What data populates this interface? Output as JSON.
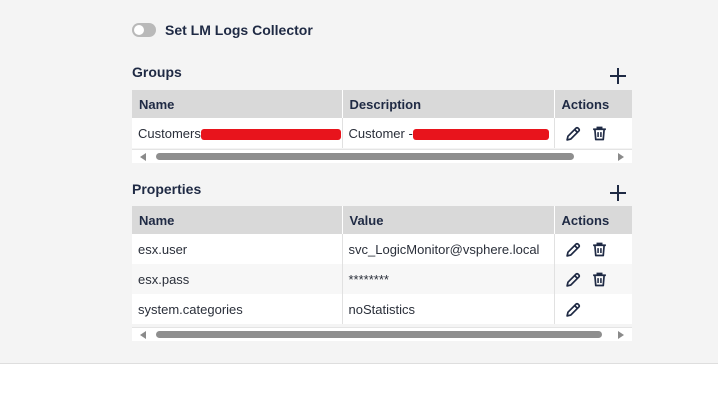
{
  "logs_collector": {
    "label": "Set LM Logs Collector",
    "enabled": false
  },
  "groups": {
    "title": "Groups",
    "columns": [
      "Name",
      "Description",
      "Actions"
    ],
    "rows": [
      {
        "name": "Customers",
        "description": "Customer -"
      }
    ]
  },
  "properties": {
    "title": "Properties",
    "columns": [
      "Name",
      "Value",
      "Actions"
    ],
    "rows": [
      {
        "name": "esx.user",
        "value": "svc_LogicMonitor@vsphere.local",
        "deletable": true
      },
      {
        "name": "esx.pass",
        "value": "********",
        "deletable": true
      },
      {
        "name": "system.categories",
        "value": "noStatistics",
        "deletable": false
      }
    ]
  },
  "icons": {
    "edit": "pencil-icon",
    "delete": "trash-icon",
    "add": "plus-icon"
  },
  "colors": {
    "accent": "#1f2a44",
    "header_bg": "#d9d9d9",
    "redaction": "#e8141c"
  }
}
